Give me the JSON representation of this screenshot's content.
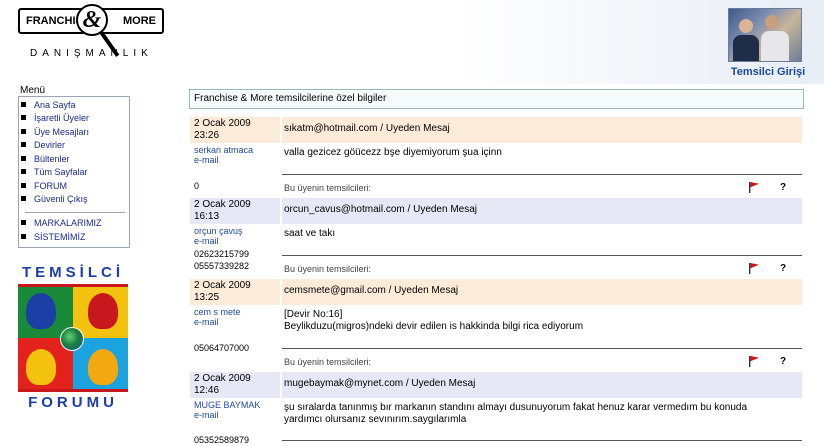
{
  "header": {
    "logo_left": "FRANCHISE",
    "logo_amp": "&",
    "logo_right": "MORE",
    "logo_sub": "DANIŞMANLIK",
    "rep_login": "Temsilci Girişi"
  },
  "sidebar": {
    "menu_title": "Menü",
    "items": [
      {
        "label": "Ana Sayfa"
      },
      {
        "label": "İşaretli Üyeler"
      },
      {
        "label": "Üye Mesajları"
      },
      {
        "label": "Devirler"
      },
      {
        "label": "Bültenler"
      },
      {
        "label": "Tüm Sayfalar"
      },
      {
        "label": "FORUM"
      },
      {
        "label": "Güvenli Çıkış"
      }
    ],
    "extra_items": [
      {
        "label": "MARKALARIMIZ"
      },
      {
        "label": "SİSTEMİMİZ"
      }
    ],
    "forum_banner": {
      "top": "TEMSİLCİ",
      "bottom": "FORUMU"
    }
  },
  "main": {
    "notice": "Franchise & More temsilcilerine özel bilgiler",
    "reps_label": "Bu üyenin temsilcileri:",
    "help_glyph": "?",
    "messages": [
      {
        "date": "2 Ocak 2009",
        "time": "23:26",
        "email": "sıkatm@hotmail.com / Uyeden Mesaj",
        "sender": "serkan atmaca",
        "sender_email_label": "e-mail",
        "phone": "0",
        "body": "valla gezicez göücezz bşe diyemiyorum şua içinn",
        "body2": ""
      },
      {
        "date": "2 Ocak 2009",
        "time": "16:13",
        "email": "orcun_cavus@hotmail.com / Uyeden Mesaj",
        "sender": "orçun çavuş",
        "sender_email_label": "e-mail",
        "phone": "02623215799",
        "phone2": "05557339282",
        "body": "saat ve takı",
        "body2": ""
      },
      {
        "date": "2 Ocak 2009",
        "time": "13:25",
        "email": "cemsmete@gmail.com / Uyeden Mesaj",
        "sender": "cem s mete",
        "sender_email_label": "e-mail",
        "phone": "05064707000",
        "body": "[Devir No:16]",
        "body2": "Beylikduzu(migros)ndeki devir edilen is hakkinda bilgi rica ediyorum"
      },
      {
        "date": "2 Ocak 2009",
        "time": "12:46",
        "email": "mugebaymak@mynet.com / Uyeden Mesaj",
        "sender": "MUGE BAYMAK",
        "sender_email_label": "e-mail",
        "phone": "05352589879",
        "body": "şu sıralarda tanınmış bır markanın standını almayı dusunuyorum fakat henuz karar vermedım bu konuda",
        "body2": "yardımcı olursanız sevınırım.saygılarımla"
      }
    ]
  },
  "colors": {
    "row_peach": "#fcebd9",
    "row_lavender": "#e6e9f5",
    "link_blue": "#1e4aa0",
    "menu_blue": "#1a2a8c",
    "flag_red": "#d0121b"
  }
}
